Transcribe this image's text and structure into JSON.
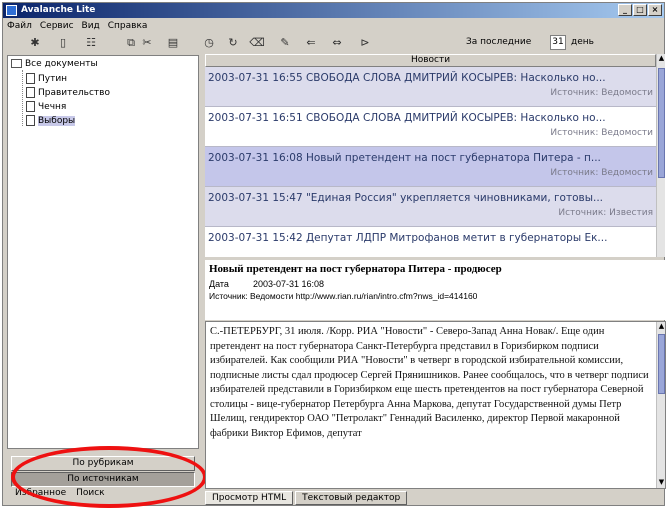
{
  "window": {
    "title": "Avalanche Lite",
    "buttons": [
      "_",
      "□",
      "×"
    ]
  },
  "menu": [
    "Файл",
    "Сервис",
    "Вид",
    "Справка"
  ],
  "toolbar": {
    "icons": [
      "bug-icon",
      "new-doc-icon",
      "grid-icon",
      "copy-icon",
      "cut-icon",
      "paste-icon",
      "clock-icon",
      "refresh-icon",
      "delete-icon",
      "properties-icon",
      "back-icon",
      "forward-icon",
      "pin-icon"
    ],
    "period_label": "За последние",
    "days_value": "31",
    "days_unit": "день"
  },
  "tree": {
    "root": "Все документы",
    "children": [
      "Путин",
      "Правительство",
      "Чечня",
      "Выборы"
    ],
    "selected": "Выборы"
  },
  "left_bottom": {
    "by_rubric": "По рубрикам",
    "by_source": "По источникам",
    "favorites": "Избранное",
    "search": "Поиск"
  },
  "news": {
    "header": "Новости",
    "items": [
      {
        "title": "2003-07-31 16:55  СВОБОДА СЛОВА ДМИТРИЙ КОСЫРЕВ: Насколько но...",
        "source": "Источник: Ведомости"
      },
      {
        "title": "2003-07-31 16:51  СВОБОДА СЛОВА ДМИТРИЙ КОСЫРЕВ: Насколько но...",
        "source": "Источник: Ведомости"
      },
      {
        "title": "2003-07-31 16:08  Новый претендент на пост губернатора Питера - п...",
        "source": "Источник: Ведомости"
      },
      {
        "title": "2003-07-31 15:47  \"Единая Россия\" укрепляется чиновниками, готовы...",
        "source": "Источник: Известия"
      },
      {
        "title": "2003-07-31 15:42  Депутат ЛДПР Митрофанов метит в губернаторы Ек...",
        "source": ""
      }
    ]
  },
  "article": {
    "title": "Новый претендент на пост губернатора Питера - продюсер",
    "date_label": "Дата",
    "date": "2003-07-31 16:08",
    "source": "Источник: Ведомости http://www.rian.ru/rian/intro.cfm?nws_id=414160",
    "body": "С.-ПЕТЕРБУРГ, 31 июля. /Корр. РИА \"Новости\" - Северо-Запад Анна Новак/. Еще один претендент на пост губернатора Санкт-Петербурга представил в Горизбирком подписи избирателей. Как сообщили РИА \"Новости\" в четверг в городской избирательной комиссии, подписные листы сдал продюсер Сергей Прянишников. Ранее сообщалось, что в четверг подписи избирателей представили в Горизбирком еще шесть претендентов на пост губернатора Северной столицы - вице-губернатор Петербурга Анна Маркова, депутат Государственной думы Петр Шелищ, гендиректор ОАО \"Петролакт\" Геннадий Василенко, директор Первой макаронной фабрики Виктор Ефимов, депутат"
  },
  "bottom_tabs": [
    "Просмотр HTML",
    "Текстовый редактор"
  ],
  "colors": {
    "title_bar": "#0a246a",
    "selection": "#c4c6ea",
    "highlight_ellipse": "#ee1111"
  }
}
